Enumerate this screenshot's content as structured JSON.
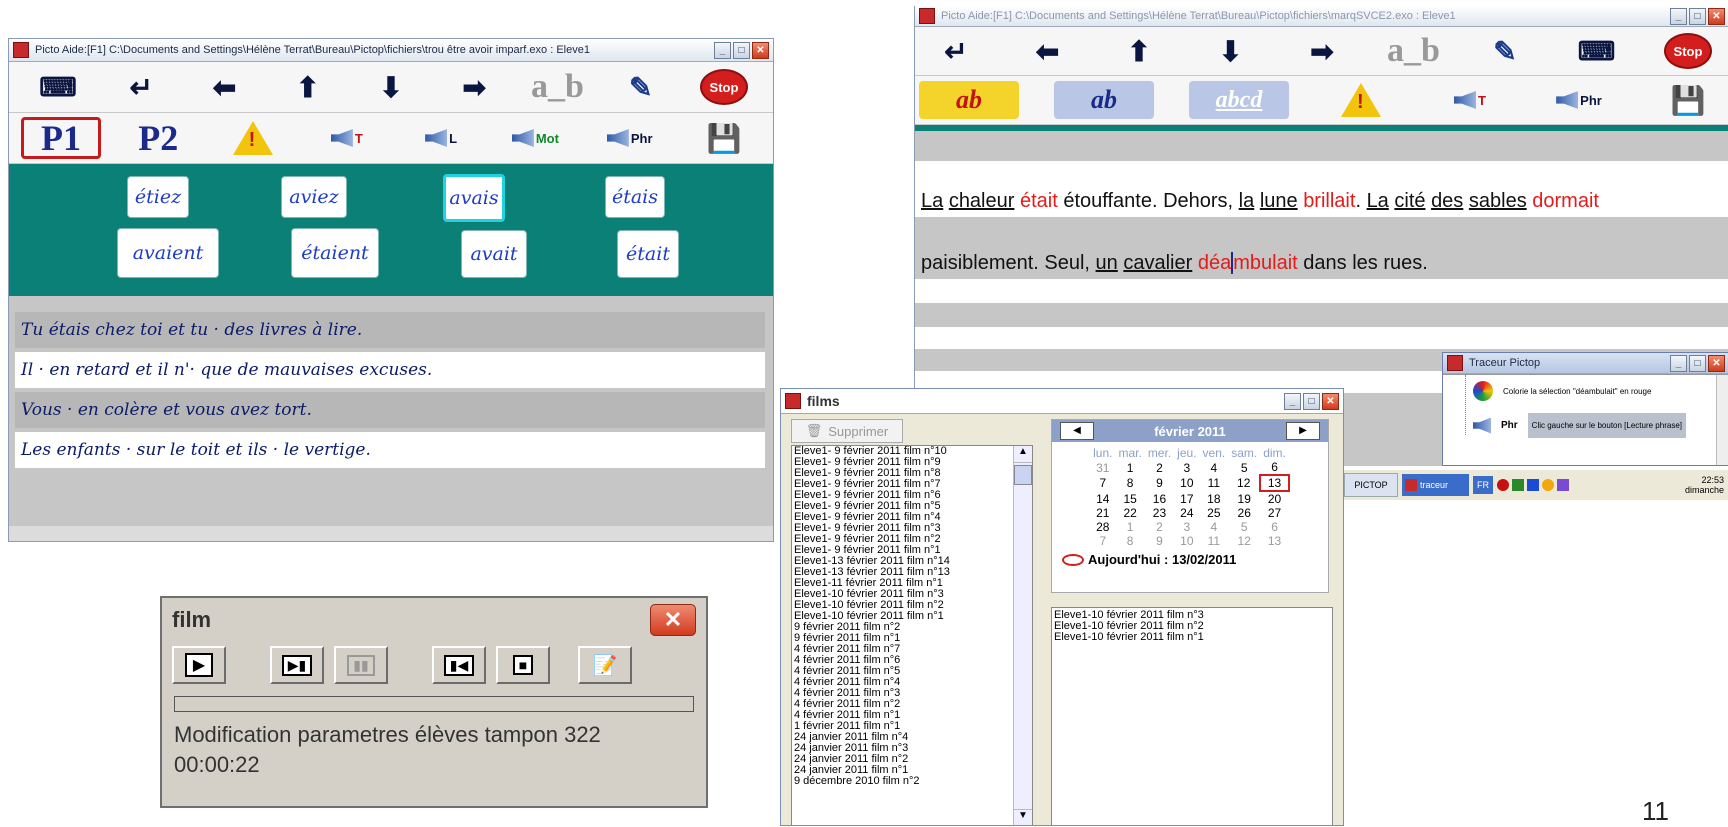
{
  "slide_number": "11",
  "win_left": {
    "title": "Picto    Aide:[F1]    C:\\Documents and Settings\\Hélène Terrat\\Bureau\\Pictop\\fichiers\\trou être avoir imparf.exo : Eleve1",
    "toolbar1": {
      "ab_label": "a_b"
    },
    "toolbar2": {
      "p1": "P1",
      "p2": "P2",
      "spk_t": "T",
      "spk_l": "L",
      "spk_mot": "Mot",
      "spk_phr": "Phr"
    },
    "words": [
      "étiez",
      "aviez",
      "avais",
      "étais",
      "avaient",
      "étaient",
      "avait",
      "était"
    ],
    "sentences": [
      "Tu étais chez toi et tu · des livres à lire.",
      "Il · en retard et il n'· que de mauvaises excuses.",
      "Vous · en colère et vous avez tort.",
      "Les enfants · sur le toit et ils · le vertige."
    ]
  },
  "film_dialog": {
    "title": "film",
    "status": "Modification parametres élèves  tampon 322",
    "time": "00:00:22"
  },
  "win_right": {
    "title": "Picto    Aide:[F1]    C:\\Documents and Settings\\Hélène Terrat\\Bureau\\Pictop\\fichiers\\marqSVCE2.exo : Eleve1",
    "toolbar1": {
      "ab_label": "a_b",
      "stop": "Stop"
    },
    "toolbar2": {
      "ab1": "ab",
      "ab2": "ab",
      "abcd": "abcd",
      "spk_t": "T",
      "spk_phr": "Phr"
    },
    "line1": {
      "w1": "La",
      "w2": "chaleur",
      "w3": "était",
      "w4": "étouffante. Dehors,",
      "w5": "la",
      "w6": "lune",
      "w7": "brillait",
      "w8": ".",
      "w9": "La",
      "w10": "cité",
      "w11": "des",
      "w12": "sables",
      "w13": "dormait"
    },
    "line2": {
      "w1": "paisiblement. Seul,",
      "w2": "un",
      "w3": "cavalier",
      "w4": "déa",
      "w5": "mbulait",
      "w6": "dans les rues."
    }
  },
  "films_window": {
    "title": "films",
    "delete_label": "Supprimer",
    "list": [
      "Eleve1- 9 février 2011 film n°10",
      "Eleve1- 9 février 2011 film n°9",
      "Eleve1- 9 février 2011 film n°8",
      "Eleve1- 9 février 2011 film n°7",
      "Eleve1- 9 février 2011 film n°6",
      "Eleve1- 9 février 2011 film n°5",
      "Eleve1- 9 février 2011 film n°4",
      "Eleve1- 9 février 2011 film n°3",
      "Eleve1- 9 février 2011 film n°2",
      "Eleve1- 9 février 2011 film n°1",
      "Eleve1-13 février 2011 film n°14",
      "Eleve1-13 février 2011 film n°13",
      "Eleve1-11 février 2011 film n°1",
      "Eleve1-10 février 2011 film n°3",
      "Eleve1-10 février 2011 film n°2",
      "Eleve1-10 février 2011 film n°1",
      " 9 février 2011 film n°2",
      " 9 février 2011 film n°1",
      " 4 février 2011 film n°7",
      " 4 février 2011 film n°6",
      " 4 février 2011 film n°5",
      " 4 février 2011 film n°4",
      " 4 février 2011 film n°3",
      " 4 février 2011 film n°2",
      " 4 février 2011 film n°1",
      " 1 février 2011 film n°1",
      "24 janvier 2011 film n°4",
      "24 janvier 2011 film n°3",
      "24 janvier 2011 film n°2",
      "24 janvier 2011 film n°1",
      " 9 décembre 2010 film n°2"
    ],
    "calendar": {
      "month": "février 2011",
      "days_header": [
        "lun.",
        "mar.",
        "mer.",
        "jeu.",
        "ven.",
        "sam.",
        "dim."
      ],
      "weeks": [
        [
          "31",
          "1",
          "2",
          "3",
          "4",
          "5",
          "6"
        ],
        [
          "7",
          "8",
          "9",
          "10",
          "11",
          "12",
          "13"
        ],
        [
          "14",
          "15",
          "16",
          "17",
          "18",
          "19",
          "20"
        ],
        [
          "21",
          "22",
          "23",
          "24",
          "25",
          "26",
          "27"
        ],
        [
          "28",
          "1",
          "2",
          "3",
          "4",
          "5",
          "6"
        ],
        [
          "7",
          "8",
          "9",
          "10",
          "11",
          "12",
          "13"
        ]
      ],
      "today": "Aujourd'hui : 13/02/2011"
    },
    "day_films": [
      "Eleve1-10 février 2011 film n°3",
      "Eleve1-10 février 2011 film n°2",
      "Eleve1-10 février 2011 film n°1"
    ]
  },
  "tracer": {
    "title": "Traceur Pictop",
    "item1": "Colorie la sélection \"déambulait\" en rouge",
    "item2": "Clic gauche sur le bouton [Lecture phrase]",
    "item2_icon": "Phr"
  },
  "taskbar": {
    "pictop": "PICTOP",
    "traceur": "traceur",
    "lang": "FR",
    "clock": "22:53",
    "day": "dimanche"
  }
}
